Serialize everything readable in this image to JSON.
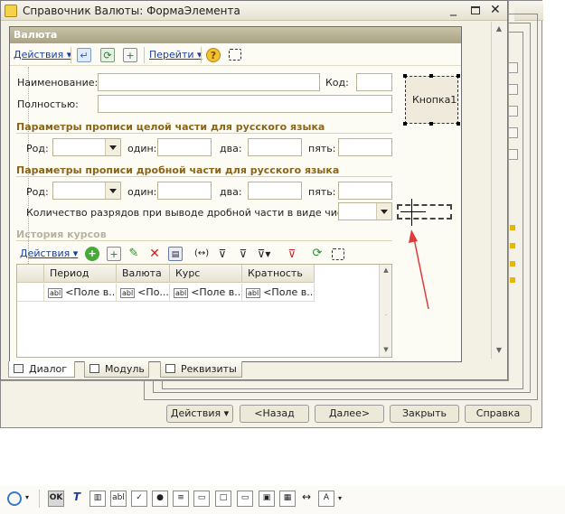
{
  "window": {
    "title": "Справочник Валюты: ФормаЭлемента"
  },
  "form": {
    "header": "Валюта",
    "toolbar": {
      "actions_label": "Действия",
      "goto_label": "Перейти"
    },
    "fields": {
      "name_label": "Наименование:",
      "code_label": "Код:",
      "full_label": "Полностью:",
      "button_label": "Кнопка1"
    },
    "section_int": {
      "title": "Параметры прописи целой части для русского языка",
      "rod": "Род:",
      "one": "один:",
      "two": "два:",
      "five": "пять:"
    },
    "section_frac": {
      "title": "Параметры прописи дробной части для русского языка",
      "rod": "Род:",
      "one": "один:",
      "two": "два:",
      "five": "пять:",
      "digits_label": "Количество разрядов при выводе дробной части в виде числа:"
    },
    "history": {
      "title": "История курсов",
      "actions_label": "Действия",
      "columns": [
        "Период",
        "Валюта",
        "Курс",
        "Кратность"
      ],
      "row": [
        "<Поле в...",
        "<По...",
        "<Поле в...",
        "<Поле в..."
      ]
    }
  },
  "tabs": [
    "Диалог",
    "Модуль",
    "Реквизиты"
  ],
  "wizard_buttons": {
    "actions": "Действия",
    "back": "<Назад",
    "next": "Далее>",
    "close": "Закрыть",
    "help": "Справка"
  },
  "colors": {
    "section_title": "#8a6418",
    "link": "#1a3f9c",
    "annotation_arrow": "#e03a3a"
  }
}
